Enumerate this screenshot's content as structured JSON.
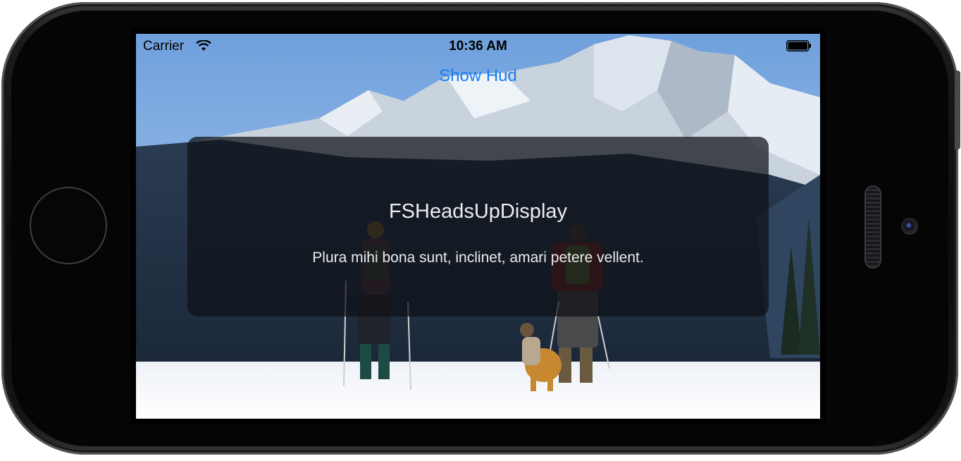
{
  "status_bar": {
    "carrier": "Carrier",
    "time": "10:36 AM",
    "wifi_icon": "wifi-icon",
    "battery_icon": "battery-icon"
  },
  "nav": {
    "show_hud_label": "Show Hud"
  },
  "hud": {
    "title": "FSHeadsUpDisplay",
    "message": "Plura mihi bona sunt, inclinet, amari petere vellent."
  },
  "colors": {
    "accent": "#1a7cf5",
    "hud_background": "#0e1016",
    "hud_text": "#ececec"
  }
}
